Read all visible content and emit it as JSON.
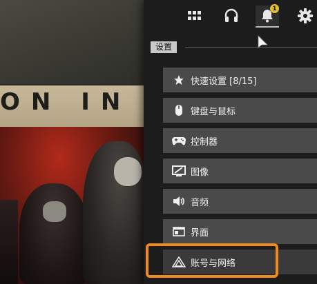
{
  "banner": {
    "text": "ON IN"
  },
  "topbar": {
    "icons": [
      "grid-icon",
      "headset-icon",
      "bell-icon",
      "gear-icon"
    ],
    "notification_count": "1"
  },
  "settings": {
    "section_label": "设置",
    "items": [
      {
        "label": "快速设置 [8/15]",
        "icon": "star-icon"
      },
      {
        "label": "键盘与鼠标",
        "icon": "mouse-icon"
      },
      {
        "label": "控制器",
        "icon": "gamepad-icon"
      },
      {
        "label": "图像",
        "icon": "display-icon"
      },
      {
        "label": "音频",
        "icon": "speaker-icon"
      },
      {
        "label": "界面",
        "icon": "window-icon"
      },
      {
        "label": "账号与网络",
        "icon": "network-icon"
      }
    ]
  },
  "colors": {
    "highlight": "#f08a1c",
    "badge": "#e6c02a",
    "menu_item_bg": "#4a4a4a"
  }
}
